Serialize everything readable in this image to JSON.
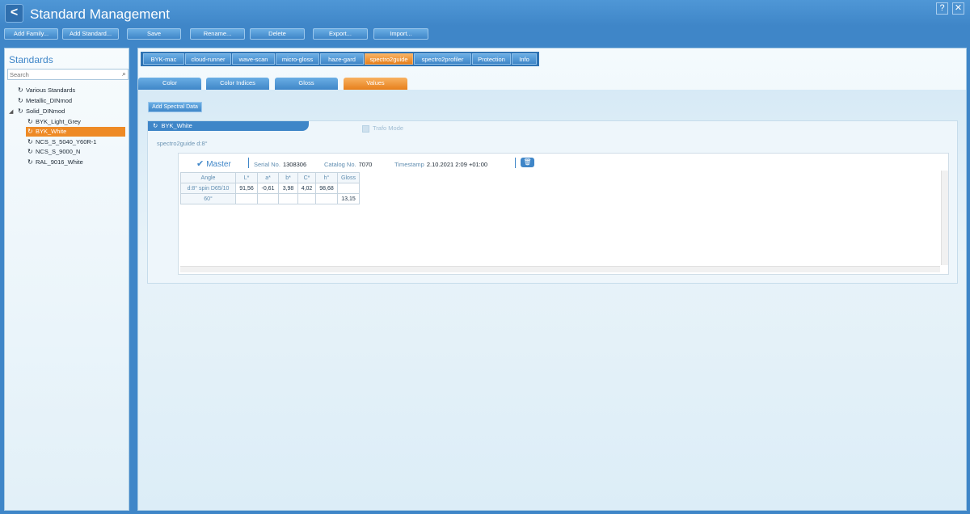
{
  "app": {
    "title": "Standard Management",
    "back_glyph": "<",
    "help_glyph": "?",
    "close_glyph": "✕"
  },
  "toolbar": {
    "add_family": "Add Family...",
    "add_standard": "Add Standard...",
    "save": "Save",
    "rename": "Rename...",
    "delete": "Delete",
    "export": "Export...",
    "import": "Import..."
  },
  "sidebar": {
    "title": "Standards",
    "search_placeholder": "Search",
    "toggle_glyph": "◢",
    "items": [
      {
        "label": "Various Standards"
      },
      {
        "label": "Metallic_DINmod"
      },
      {
        "label": "Solid_DINmod"
      },
      {
        "label": "BYK_Light_Grey"
      },
      {
        "label": "BYK_White"
      },
      {
        "label": "NCS_S_5040_Y60R-1"
      },
      {
        "label": "NCS_S_9000_N"
      },
      {
        "label": "RAL_9016_White"
      }
    ]
  },
  "device_tabs": [
    "BYK-mac",
    "cloud-runner",
    "wave-scan",
    "micro-gloss",
    "haze-gard",
    "spectro2guide",
    "spectro2profiler",
    "Protection",
    "Info"
  ],
  "sub_tabs": [
    "Color",
    "Color Indices",
    "Gloss",
    "Values"
  ],
  "content": {
    "add_spectral": "Add Spectral Data",
    "standard_name": "BYK_White",
    "trafo_mode": "Trafo Mode",
    "device_label": "spectro2guide d:8°",
    "master": "Master",
    "serial_label": "Serial No.",
    "serial_value": "1308306",
    "catalog_label": "Catalog No.",
    "catalog_value": "7070",
    "timestamp_label": "Timestamp",
    "timestamp_value": "2.10.2021 2:09  +01:00",
    "trash_glyph": "🗑"
  },
  "table": {
    "headers": [
      "Angle",
      "L*",
      "a*",
      "b*",
      "C*",
      "h°",
      "Gloss"
    ],
    "rows": [
      [
        "d:8° spin D65/10",
        "91,56",
        "-0,61",
        "3,98",
        "4,02",
        "98,68",
        ""
      ],
      [
        "60°",
        "",
        "",
        "",
        "",
        "",
        "13,15"
      ]
    ]
  },
  "colors": {
    "accent": "#3f86c8",
    "selected": "#ee8a25"
  }
}
